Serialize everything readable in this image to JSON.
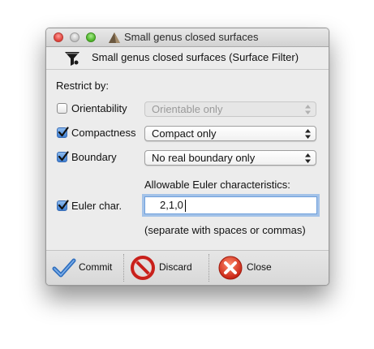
{
  "window": {
    "title": "Small genus closed surfaces"
  },
  "header": {
    "icon": "funnel-filter-icon",
    "text": "Small genus closed surfaces (Surface Filter)"
  },
  "form": {
    "restrict_label": "Restrict by:",
    "rows": [
      {
        "label": "Orientability",
        "checked": false,
        "value": "Orientable only",
        "enabled": false
      },
      {
        "label": "Compactness",
        "checked": true,
        "value": "Compact only",
        "enabled": true
      },
      {
        "label": "Boundary",
        "checked": true,
        "value": "No real boundary only",
        "enabled": true
      }
    ],
    "euler": {
      "caption": "Allowable Euler characteristics:",
      "label": "Euler char.",
      "checked": true,
      "value": "2,1,0",
      "hint": "(separate with spaces or commas)"
    }
  },
  "buttons": {
    "commit": "Commit",
    "discard": "Discard",
    "close": "Close"
  },
  "colors": {
    "accent": "#3f7fd1",
    "commit_icon": "#2f6fbf",
    "discard_icon": "#c8201b",
    "close_icon": "#d83a1e"
  }
}
